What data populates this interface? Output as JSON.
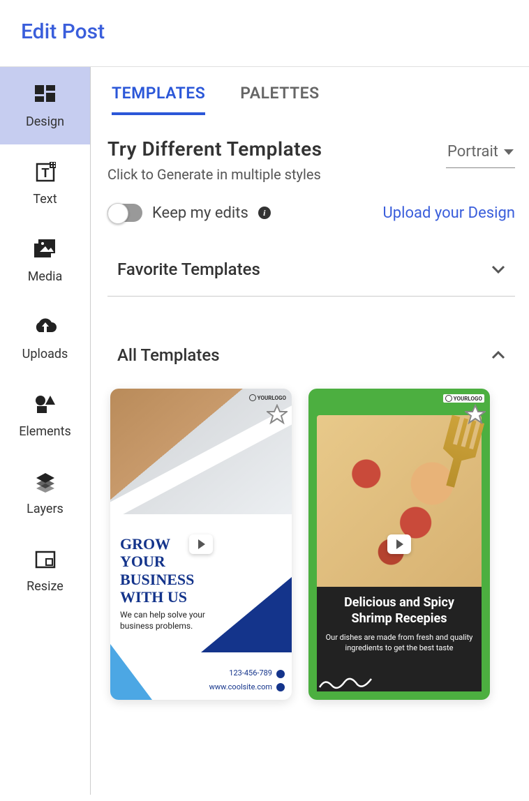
{
  "header": {
    "title": "Edit Post"
  },
  "sidebar": {
    "items": [
      {
        "label": "Design",
        "icon": "design-icon",
        "active": true
      },
      {
        "label": "Text",
        "icon": "text-icon",
        "active": false
      },
      {
        "label": "Media",
        "icon": "media-icon",
        "active": false
      },
      {
        "label": "Uploads",
        "icon": "uploads-icon",
        "active": false
      },
      {
        "label": "Elements",
        "icon": "elements-icon",
        "active": false
      },
      {
        "label": "Layers",
        "icon": "layers-icon",
        "active": false
      },
      {
        "label": "Resize",
        "icon": "resize-icon",
        "active": false
      }
    ]
  },
  "tabs": {
    "templates": "TEMPLATES",
    "palettes": "PALETTES"
  },
  "heading": {
    "title": "Try Different Templates",
    "subtitle": "Click to Generate in multiple styles"
  },
  "orientation": {
    "selected": "Portrait"
  },
  "options": {
    "keep_edits_label": "Keep my edits",
    "upload_link": "Upload your Design"
  },
  "sections": {
    "favorite": "Favorite Templates",
    "all": "All Templates"
  },
  "templates": [
    {
      "logo": "YOURLOGO",
      "slogan": "GROW YOUR BUSINESS WITH US",
      "sub": "We can help solve your business problems.",
      "phone": "123-456-789",
      "site": "www.coolsite.com"
    },
    {
      "logo": "YOURLOGO",
      "title": "Delicious and Spicy Shrimp Recepies",
      "sub": "Our dishes are made from fresh and quality ingredients to get the best taste"
    }
  ]
}
